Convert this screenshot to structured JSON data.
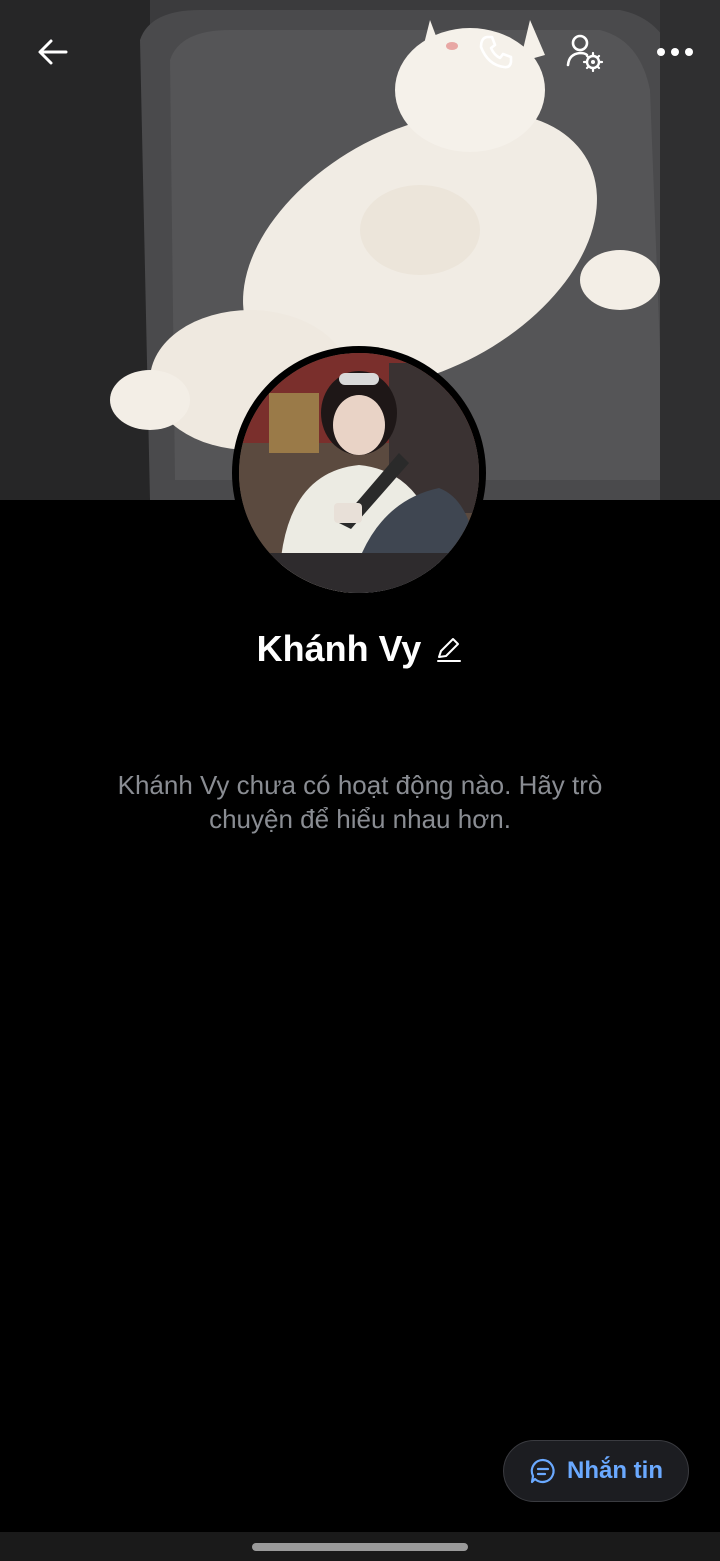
{
  "profile": {
    "name": "Khánh Vy",
    "empty_message": "Khánh Vy chưa có hoạt động nào. Hãy trò chuyện để hiểu nhau hơn."
  },
  "actions": {
    "message_label": "Nhắn tin"
  },
  "icons": {
    "back": "arrow-left-icon",
    "call": "phone-icon",
    "settings": "user-settings-icon",
    "more": "more-horizontal-icon",
    "edit": "pencil-icon",
    "message": "chat-bubble-icon"
  },
  "colors": {
    "accent": "#6aa9ff",
    "muted_text": "#8a8d93",
    "background": "#000000"
  }
}
